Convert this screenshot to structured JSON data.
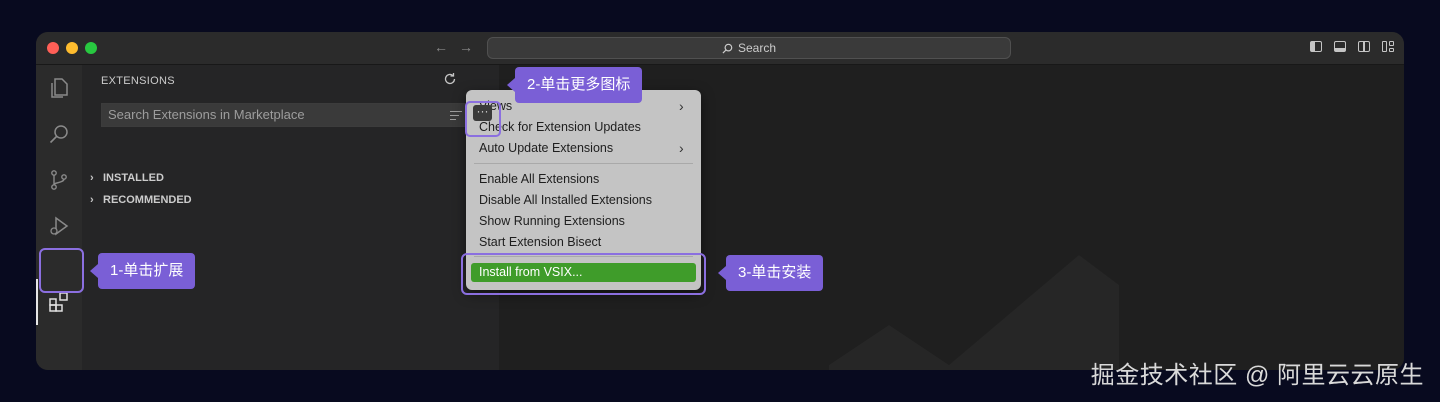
{
  "window": {
    "search_label": "Search"
  },
  "sidebar": {
    "title": "EXTENSIONS",
    "search_placeholder": "Search Extensions in Marketplace",
    "sections": [
      {
        "label": "INSTALLED"
      },
      {
        "label": "RECOMMENDED"
      }
    ]
  },
  "more_actions": {
    "label": "···"
  },
  "menu": {
    "items": [
      {
        "label": "Views",
        "submenu": true
      },
      {
        "label": "Check for Extension Updates"
      },
      {
        "label": "Auto Update Extensions",
        "submenu": true
      },
      {
        "label": "Enable All Extensions"
      },
      {
        "label": "Disable All Installed Extensions"
      },
      {
        "label": "Show Running Extensions"
      },
      {
        "label": "Start Extension Bisect"
      },
      {
        "label": "Install from VSIX..."
      }
    ]
  },
  "callouts": {
    "step1": "1-单击扩展",
    "step2": "2-单击更多图标",
    "step3": "3-单击安装"
  },
  "watermark": "掘金技术社区 @ 阿里云云原生",
  "colors": {
    "accent": "#7a5fd6",
    "highlight_outline": "#8b6fe0",
    "selected_menu": "#3f9c2a"
  }
}
